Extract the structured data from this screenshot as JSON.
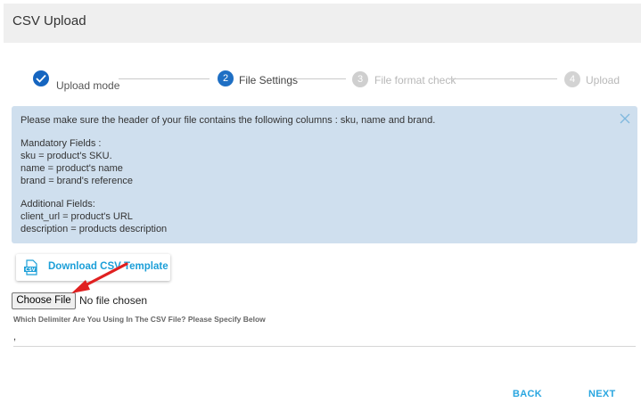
{
  "header": {
    "title": "CSV Upload"
  },
  "stepper": {
    "steps": [
      {
        "number": "1",
        "label": "Upload mode",
        "state": "done"
      },
      {
        "number": "2",
        "label": "File Settings",
        "state": "active"
      },
      {
        "number": "3",
        "label": "File format check",
        "state": "pending"
      },
      {
        "number": "4",
        "label": "Upload",
        "state": "pending"
      }
    ]
  },
  "info": {
    "intro": "Please make sure the header of your file contains the following columns : sku, name and brand.",
    "mandatory_title": "Mandatory Fields :",
    "mandatory": [
      "sku = product's SKU.",
      "name = product's name",
      "brand = brand's reference"
    ],
    "additional_title": "Additional Fields:",
    "additional": [
      "client_url = product's URL",
      "description = products description"
    ]
  },
  "download": {
    "label": "Download CSV Template",
    "icon": "csv-file-icon"
  },
  "file_input": {
    "button_label": "Choose File",
    "status": "No file chosen"
  },
  "delimiter": {
    "label": "Which Delimiter Are You Using In The CSV File? Please Specify Below",
    "value": ","
  },
  "actions": {
    "back": "BACK",
    "next": "NEXT"
  },
  "colors": {
    "primary": "#1565c0",
    "accent": "#29a6e0",
    "info_bg": "#cfdfee",
    "annotation_arrow": "#e02020"
  }
}
